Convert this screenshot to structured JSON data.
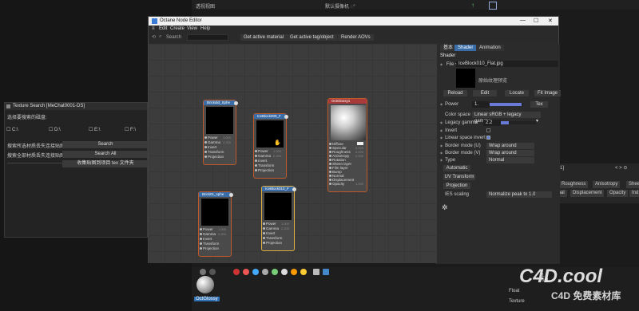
{
  "viewport": {
    "left_title": "透视视图",
    "camera": "默认摄像机 ◌°"
  },
  "texture_search": {
    "title": "Texture Search [MeChat0001-DS]",
    "drive_label": "选择要搜索的磁盘:",
    "drives": [
      "C:\\",
      "D:\\",
      "E:\\",
      "F:\\"
    ],
    "label_search": "搜索所选材质丢失连接贴图:",
    "label_search_all": "搜索全部材质丢失连接贴图:",
    "search_button": "Search",
    "search_all_button": "Search All",
    "collect_button": "收集贴图到项目 tex 文件夹",
    "separator_text": "-----------------------------------"
  },
  "node_editor": {
    "title": "Octane Node Editor",
    "menu": [
      "Edit",
      "Create",
      "View",
      "Help"
    ],
    "search_label": "Search",
    "search_value": "",
    "toolbar_buttons": [
      "Get active material",
      "Get active tag/object",
      "Render AOVs"
    ],
    "nodes": [
      {
        "title": "Brickdid_Sphe",
        "ports": [
          "Power",
          "Gamma",
          "Invert",
          "Transform",
          "Projection"
        ],
        "values": [
          "1.000",
          "2.200"
        ]
      },
      {
        "title": "IceBlock009_F",
        "ports": [
          "Power",
          "Gamma",
          "Invert",
          "Transform",
          "Projection"
        ],
        "values": [
          "1.000",
          "2.200"
        ]
      },
      {
        "title": "Brick01_sphe",
        "ports": [
          "Power",
          "Gamma",
          "Invert",
          "Transform",
          "Projection"
        ],
        "values": [
          "1.000",
          "2.200"
        ]
      },
      {
        "title": "IceBlock010_F",
        "ports": [
          "Power",
          "Gamma",
          "Invert",
          "Transform",
          "Projection"
        ],
        "values": [
          "1.000",
          "2.200"
        ]
      }
    ],
    "material_node": {
      "title": "OctGlossy1",
      "ports": [
        "Diffuse",
        "Specular",
        "Roughness",
        "Anisotropy",
        "Rotation",
        "Sheen layer",
        "Film layer",
        "Bump",
        "Normal",
        "Displacement",
        "Opacity"
      ],
      "values": [
        "0.000",
        "0.000",
        "0.000",
        "1.000"
      ]
    }
  },
  "properties": {
    "tabs": [
      "基本",
      "Shader",
      "Animation"
    ],
    "section": "Shader",
    "file_label": "File",
    "file_value": "IceBlock010_Flat.jpg",
    "preview_caption": "原始纹理预览",
    "buttons": [
      "Reload",
      "Edit",
      "Locate",
      "Fit Image"
    ],
    "power_label": "Power",
    "power_value": "1.",
    "power_fraction": 0.95,
    "tex_button": "Tex",
    "color_space_label": "Color space",
    "color_space_value": "Linear sRGB + legacy gamma",
    "legacy_gamma_label": "Legacy gamma",
    "legacy_gamma_value": "2.2",
    "legacy_gamma_fraction": 0.22,
    "invert_label": "Invert",
    "linear_invert_label": "Linear space invert",
    "border_u_label": "Border mode (U)",
    "border_u_value": "Wrap around",
    "border_v_label": "Border mode (V)",
    "border_v_value": "Wrap around",
    "type_label": "Type",
    "type_value": "Normal",
    "automatic_button": "Automatic",
    "uv_transform_button": "UV Transform",
    "projection_button": "Projection",
    "ies_label": "IES scaling",
    "ies_value": "Normalize peak to 1.0"
  },
  "background_panel": {
    "top_label": "y1]",
    "tabs_row1": [
      "Roughness",
      "Anisotropy",
      "Shee"
    ],
    "tabs_row2": [
      "mal",
      "Displacement",
      "Opacity",
      "Ind"
    ]
  },
  "bottom": {
    "material_label": "OctGlossy",
    "float_label": "Float",
    "texture_label": "Texture",
    "vals": [
      "1",
      "0.9"
    ],
    "watermark_top": "C4D.cool",
    "watermark_bottom": "C4D 免费素材库"
  }
}
